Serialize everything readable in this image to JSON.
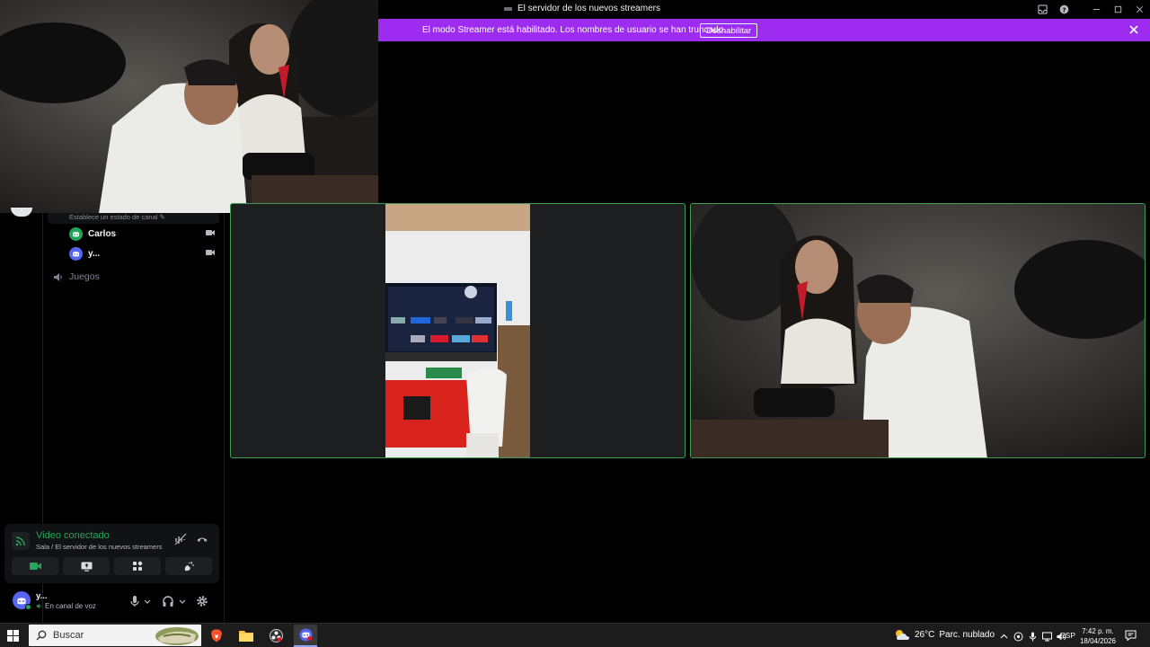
{
  "window": {
    "title": "El servidor de los nuevos streamers"
  },
  "streamer_banner": {
    "text": "El modo Streamer está habilitado. Los nombres de usuario se han truncado.",
    "button_label": "Deshabilitar"
  },
  "channels": {
    "status_placeholder": "Establece un estado de canal",
    "voice_users": [
      {
        "name": "Carlos",
        "avatar_color": "#23a55a"
      },
      {
        "name": "y...",
        "avatar_color": "#5865f2"
      }
    ],
    "voice_channel": "Juegos"
  },
  "voice_panel": {
    "title": "Video conectado",
    "subtitle": "Sala / El servidor de los nuevos streamers"
  },
  "user_panel": {
    "name": "y...",
    "status": "En canal de voz"
  },
  "taskbar": {
    "search_placeholder": "Buscar",
    "weather_temp": "26°C",
    "weather_text": "Parc. nublado",
    "language": "ESP",
    "time": "7:42 p. m.",
    "date": "18/04/2026"
  },
  "colors": {
    "accent_purple": "#9d2cf0",
    "speaking_green": "#3f9b56",
    "connected_green": "#23a55a",
    "blurple": "#5865f2"
  }
}
